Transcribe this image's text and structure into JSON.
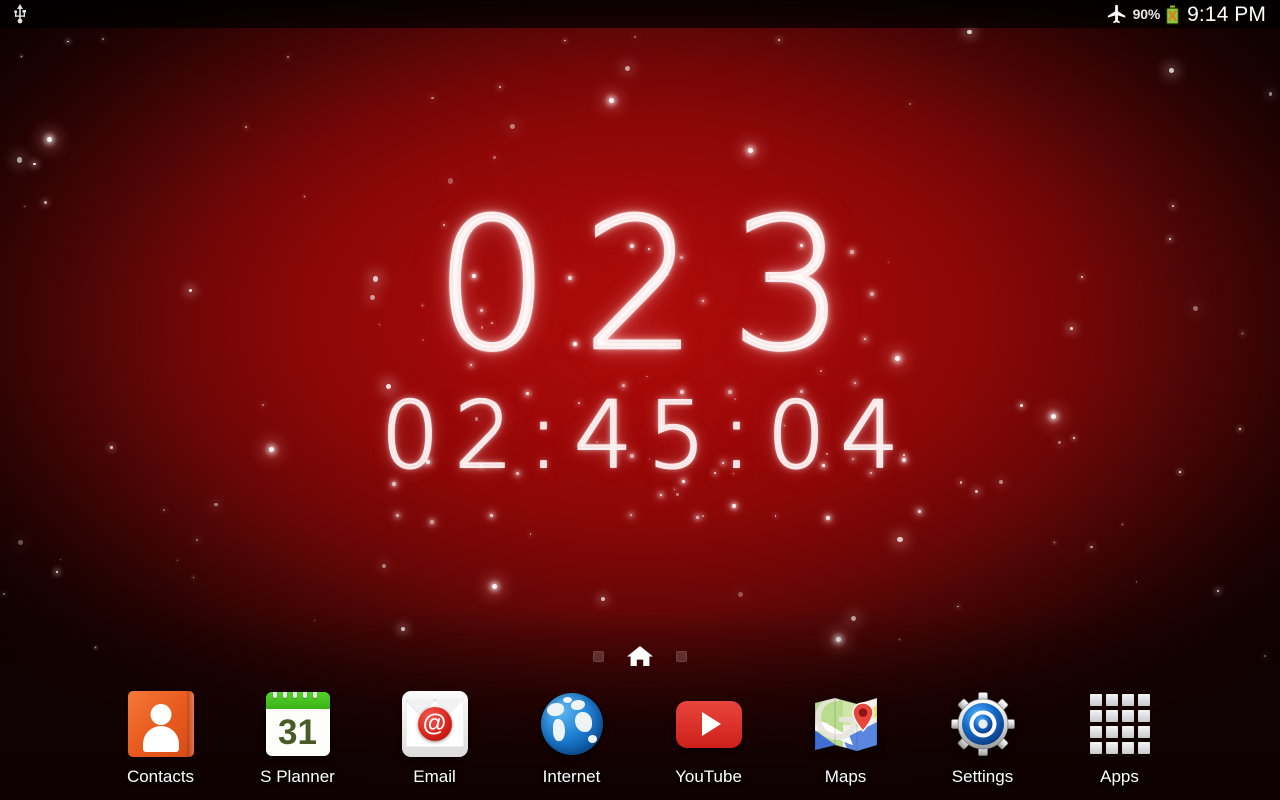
{
  "status_bar": {
    "usb_icon": "usb-icon",
    "airplane_icon": "airplane-mode-icon",
    "battery_percent": "90%",
    "battery_icon": "battery-icon",
    "clock": "9:14 PM"
  },
  "wallpaper": {
    "name": "sparkle-red-gradient-wallpaper",
    "center_color": "#ad0b0b",
    "edge_color": "#1a0202"
  },
  "countdown_widget": {
    "name": "countdown-clock-widget",
    "days": "023",
    "time": "02:45:04",
    "glow_color": "#ffe9e9"
  },
  "page_indicator": {
    "left_dot": "page-dot",
    "home_icon": "home-icon",
    "right_dot": "page-dot"
  },
  "dock": {
    "items": [
      {
        "label": "Contacts",
        "icon": "contacts-icon"
      },
      {
        "label": "S Planner",
        "icon": "calendar-icon",
        "day": "31"
      },
      {
        "label": "Email",
        "icon": "email-icon",
        "glyph": "@"
      },
      {
        "label": "Internet",
        "icon": "globe-icon"
      },
      {
        "label": "YouTube",
        "icon": "youtube-icon"
      },
      {
        "label": "Maps",
        "icon": "maps-icon"
      },
      {
        "label": "Settings",
        "icon": "gear-icon"
      },
      {
        "label": "Apps",
        "icon": "apps-grid-icon"
      }
    ]
  }
}
